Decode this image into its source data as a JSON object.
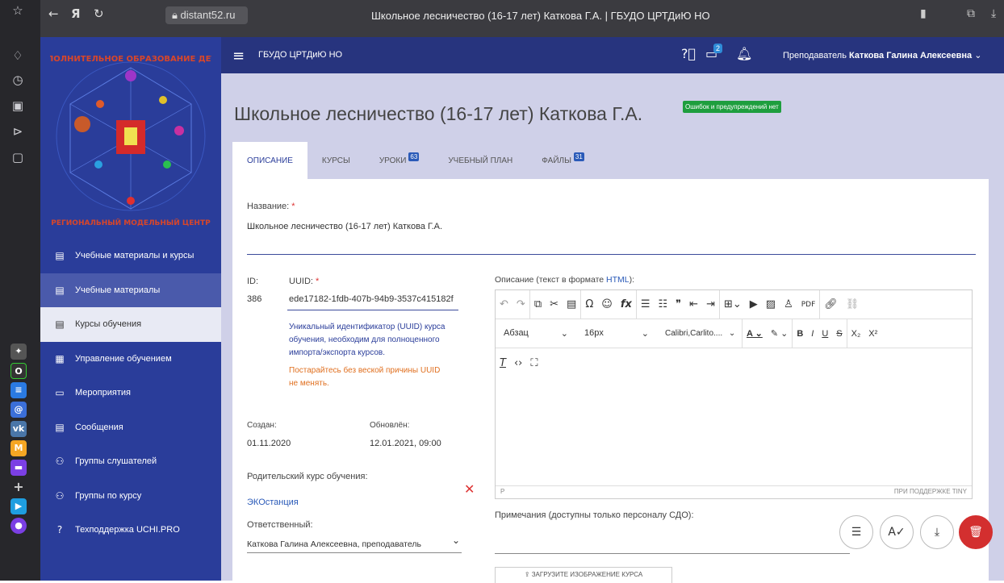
{
  "browser": {
    "url_domain": "distant52.ru",
    "tab_title": "Школьное лесничество (16-17 лет) Каткова Г.А. | ГБУДО ЦРТДиЮ НО",
    "yandex_glyph": "Я"
  },
  "header": {
    "org_name": "ГБУДО ЦРТДиЮ НО",
    "courses_badge": "2",
    "user_role": "Преподаватель",
    "user_name": "Каткова Галина Алексеевна"
  },
  "sidebar": {
    "logo_text_top": "ДОПОЛНИТЕЛЬНОЕ ОБРАЗОВАНИЕ ДЕТЕЙ",
    "logo_text_bottom": "РЕГИОНАЛЬНЫЙ МОДЕЛЬНЫЙ ЦЕНТР",
    "items": [
      {
        "label": "Учебные материалы и курсы",
        "icon": "book-icon"
      },
      {
        "label": "Учебные материалы",
        "icon": "book-icon"
      },
      {
        "label": "Курсы обучения",
        "icon": "list-icon"
      },
      {
        "label": "Управление обучением",
        "icon": "clipboard-icon"
      },
      {
        "label": "Мероприятия",
        "icon": "cast-icon"
      },
      {
        "label": "Сообщения",
        "icon": "message-icon"
      },
      {
        "label": "Группы слушателей",
        "icon": "group-icon"
      },
      {
        "label": "Группы по курсу",
        "icon": "group-icon"
      },
      {
        "label": "Техподдержка UCHI.PRO",
        "icon": "help-icon"
      }
    ]
  },
  "page": {
    "title": "Школьное лесничество (16-17 лет) Каткова Г.А.",
    "status_badge": "Ошибок и предупреждений нет",
    "tabs": [
      {
        "label": "ОПИСАНИЕ",
        "count": ""
      },
      {
        "label": "КУРСЫ",
        "count": ""
      },
      {
        "label": "УРОКИ",
        "count": "63"
      },
      {
        "label": "УЧЕБНЫЙ ПЛАН",
        "count": ""
      },
      {
        "label": "ФАЙЛЫ",
        "count": "31"
      }
    ]
  },
  "form": {
    "name_label": "Название:",
    "name_value": "Школьное лесничество (16-17 лет) Каткова Г.А.",
    "id_label": "ID:",
    "id_value": "386",
    "uuid_label": "UUID:",
    "uuid_value": "ede17182-1fdb-407b-94b9-3537c415182f",
    "uuid_note_1": "Уникальный идентификатор (UUID) курса обучения, необходим для полноценного импорта/экспорта курсов.",
    "uuid_note_2": "Постарайтесь без веской причины UUID не менять.",
    "created_label": "Создан:",
    "created_value": "01.11.2020",
    "updated_label": "Обновлён:",
    "updated_value": "12.01.2021, 09:00",
    "parent_label": "Родительский курс обучения:",
    "parent_value": "ЭКОстанция",
    "resp_label": "Ответственный:",
    "resp_value": "Каткова Галина Алексеевна, преподаватель",
    "desc_label": "Описание (текст в формате",
    "desc_label_link": "HTML",
    "desc_label_end": "):",
    "notes_label": "Примечания (доступны только персоналу СДО):",
    "upload_label": "ЗАГРУЗИТЕ ИЗОБРАЖЕНИЕ КУРСА"
  },
  "editor": {
    "block_format": "Абзац",
    "font_size": "16px",
    "font_family": "Calibri,Carlito....",
    "pdf_label": "PDF",
    "status_left": "P",
    "status_right": "ПРИ ПОДДЕРЖКЕ TINY"
  },
  "colors": {
    "sidebar_bg": "#2a3d9a",
    "topbar_bg": "#27347e",
    "main_bg": "#cfd0e8",
    "success": "#1e9e3e",
    "danger": "#d32f2f"
  }
}
